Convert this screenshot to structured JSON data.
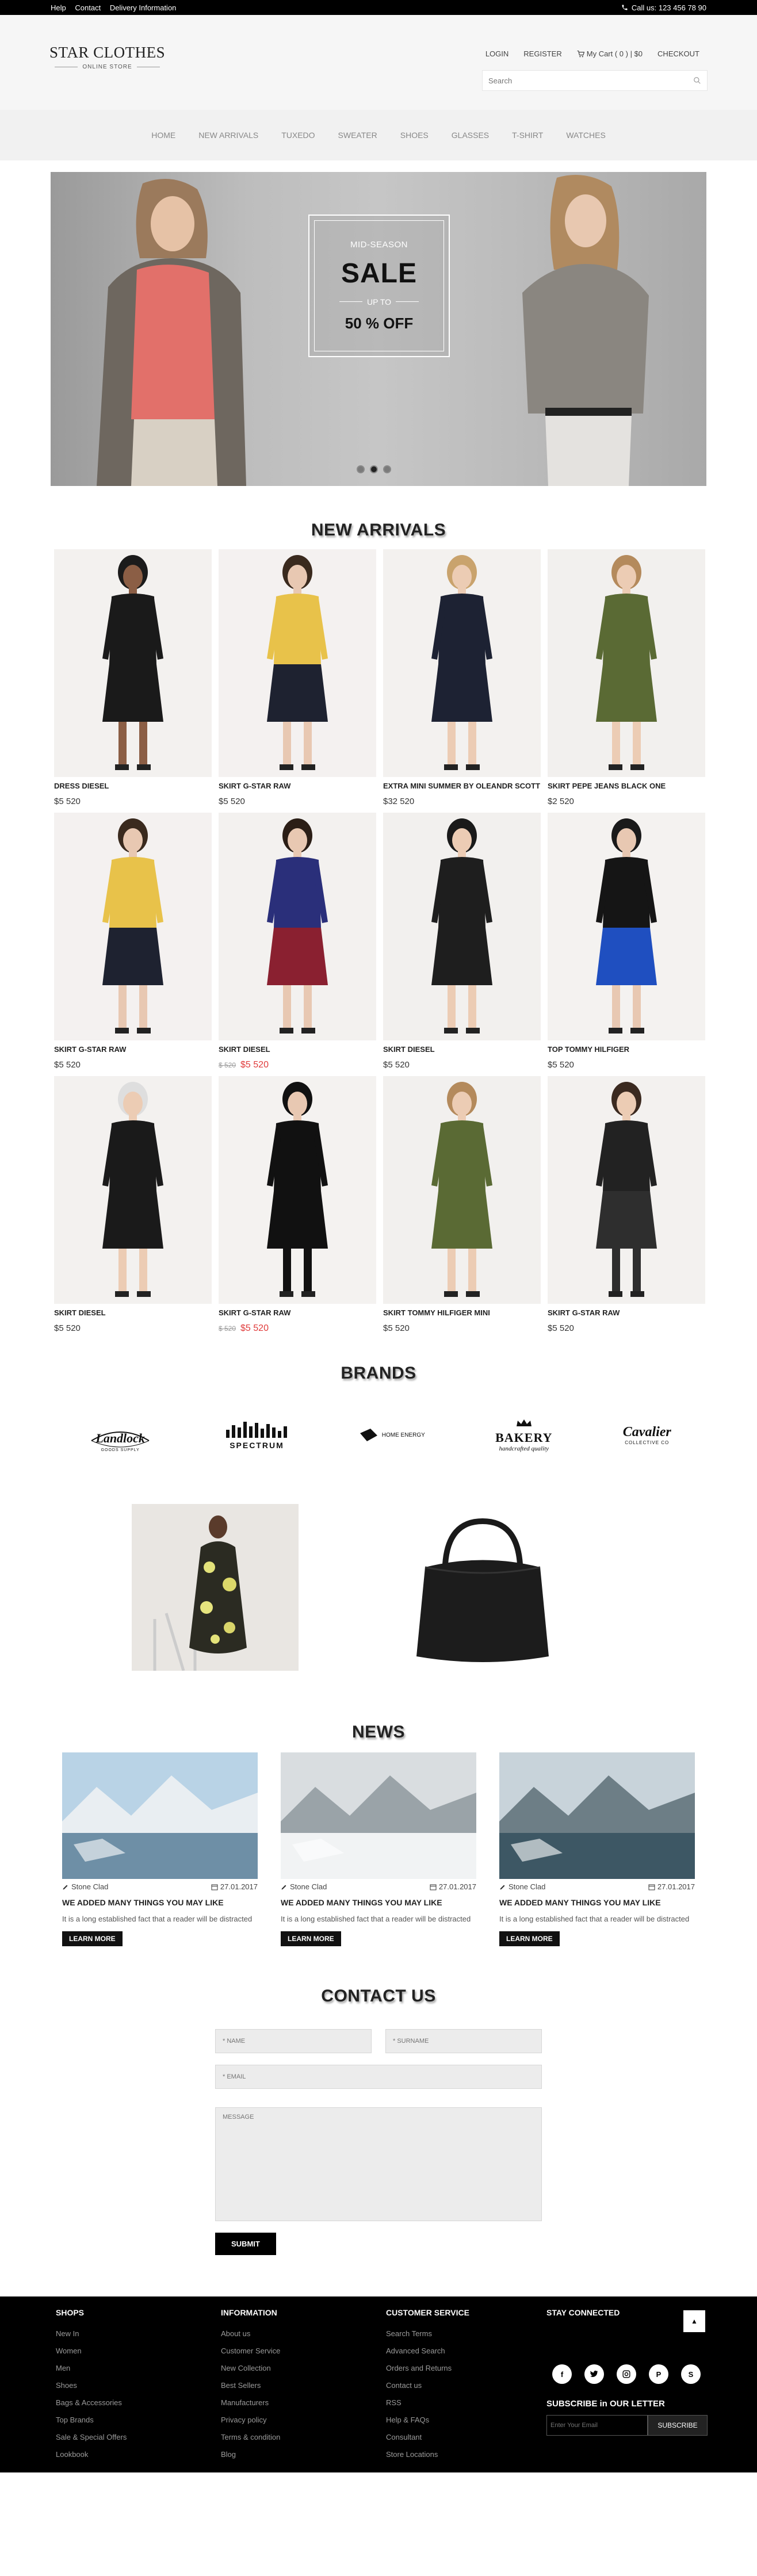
{
  "topbar": {
    "links": [
      "Help",
      "Contact",
      "Delivery Information"
    ],
    "phone": "Call us: 123 456 78 90"
  },
  "header": {
    "logo_name": "STAR CLOTHES",
    "logo_sub": "ONLINE STORE",
    "login": "LOGIN",
    "register": "REGISTER",
    "cart": "My Cart ( 0 ) | $0",
    "checkout": "CHECKOUT",
    "search_placeholder": "Search"
  },
  "nav": [
    "HOME",
    "NEW ARRIVALS",
    "TUXEDO",
    "SWEATER",
    "SHOES",
    "GLASSES",
    "T-SHIRT",
    "WATCHES"
  ],
  "hero": {
    "mid": "MID-SEASON",
    "big": "SALE",
    "upto": "UP TO",
    "pct": "50 % OFF",
    "active_dot": 1
  },
  "new_arrivals_title": "NEW ARRIVALS",
  "products": [
    {
      "name": "DRESS DIESEL",
      "price": "$5 520",
      "old": "",
      "sale": ""
    },
    {
      "name": "SKIRT G-STAR RAW",
      "price": "$5 520",
      "old": "",
      "sale": ""
    },
    {
      "name": "EXTRA MINI SUMMER BY OLEANDR SCOTT",
      "price": "$32 520",
      "old": "",
      "sale": ""
    },
    {
      "name": "SKIRT PEPE JEANS BLACK ONE",
      "price": "$2 520",
      "old": "",
      "sale": ""
    },
    {
      "name": "SKIRT G-STAR RAW",
      "price": "$5 520",
      "old": "",
      "sale": ""
    },
    {
      "name": "SKIRT DIESEL",
      "price": "",
      "old": "$ 520",
      "sale": "$5 520"
    },
    {
      "name": "SKIRT DIESEL",
      "price": "$5 520",
      "old": "",
      "sale": ""
    },
    {
      "name": "TOP TOMMY HILFIGER",
      "price": "$5 520",
      "old": "",
      "sale": ""
    },
    {
      "name": "SKIRT DIESEL",
      "price": "$5 520",
      "old": "",
      "sale": ""
    },
    {
      "name": "SKIRT G-STAR RAW",
      "price": "",
      "old": "$ 520",
      "sale": "$5 520"
    },
    {
      "name": "SKIRT TOMMY HILFIGER MINI",
      "price": "$5 520",
      "old": "",
      "sale": ""
    },
    {
      "name": "SKIRT G-STAR RAW",
      "price": "$5 520",
      "old": "",
      "sale": ""
    }
  ],
  "brands_title": "BRANDS",
  "brands": [
    {
      "name": "Landlock",
      "sub": "GOODS SUPPLY"
    },
    {
      "name": "SPECTRUM",
      "sub": ""
    },
    {
      "name": "HOME ENERGY",
      "sub": ""
    },
    {
      "name": "BAKERY",
      "sub": "handcrafted quality"
    },
    {
      "name": "Cavalier",
      "sub": "COLLECTIVE CO"
    }
  ],
  "news_title": "NEWS",
  "news": [
    {
      "author": "Stone Clad",
      "date": "27.01.2017",
      "title": "WE ADDED MANY THINGS YOU MAY LIKE",
      "text": "It is a long established fact that a reader will be distracted",
      "button": "LEARN MORE"
    },
    {
      "author": "Stone Clad",
      "date": "27.01.2017",
      "title": "WE ADDED MANY THINGS YOU MAY LIKE",
      "text": "It is a long established fact that a reader will be distracted",
      "button": "LEARN MORE"
    },
    {
      "author": "Stone Clad",
      "date": "27.01.2017",
      "title": "WE ADDED MANY THINGS YOU MAY LIKE",
      "text": "It is a long established fact that a reader will be distracted",
      "button": "LEARN MORE"
    }
  ],
  "contact": {
    "title": "CONTACT US",
    "name_ph": "* NAME",
    "surname_ph": "* SURNAME",
    "email_ph": "* EMAIL",
    "message_ph": "MESSAGE",
    "submit": "SUBMIT"
  },
  "footer": {
    "shops": {
      "title": "SHOPS",
      "items": [
        "New In",
        "Women",
        "Men",
        "Shoes",
        "Bags & Accessories",
        "Top Brands",
        "Sale & Special Offers",
        "Lookbook"
      ]
    },
    "information": {
      "title": "INFORMATION",
      "items": [
        "About us",
        "Customer Service",
        "New Collection",
        "Best Sellers",
        "Manufacturers",
        "Privacy policy",
        "Terms & condition",
        "Blog"
      ]
    },
    "customer_service": {
      "title": "CUSTOMER SERVICE",
      "items": [
        "Search Terms",
        "Advanced Search",
        "Orders and Returns",
        "Contact us",
        "RSS",
        "Help & FAQs",
        "Consultant",
        "Store Locations"
      ]
    },
    "stay_connected": "STAY CONNECTED",
    "up": "▲",
    "social_icons": [
      "facebook-icon",
      "twitter-icon",
      "instagram-icon",
      "pinterest-icon",
      "skype-icon"
    ],
    "subscribe_title": "SUBSCRIBE in OUR LETTER",
    "email_ph": "Enter Your Email",
    "subscribe_btn": "SUBSCRIBE"
  }
}
